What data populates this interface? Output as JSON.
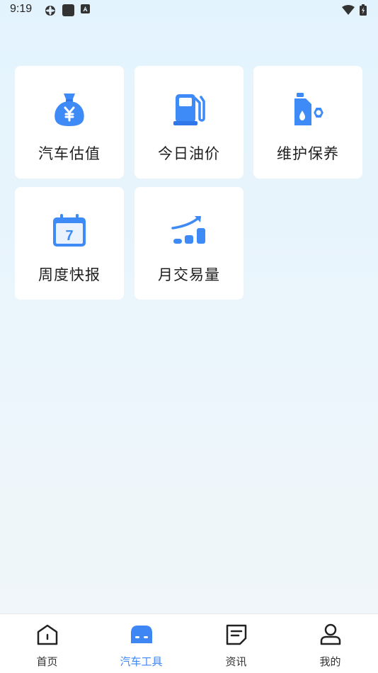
{
  "status_bar": {
    "time": "9:19",
    "icons": [
      "settings-gear-icon",
      "app-square-icon",
      "keyboard-a-icon",
      "wifi-icon",
      "battery-icon"
    ]
  },
  "tools": [
    {
      "label": "汽车估值",
      "icon": "money-bag-icon"
    },
    {
      "label": "今日油价",
      "icon": "fuel-pump-icon"
    },
    {
      "label": "维护保养",
      "icon": "maintenance-oil-icon"
    },
    {
      "label": "周度快报",
      "icon": "calendar-icon"
    },
    {
      "label": "月交易量",
      "icon": "growth-chart-icon"
    }
  ],
  "calendar_day": "7",
  "tabbar": {
    "items": [
      {
        "label": "首页",
        "icon": "home-icon"
      },
      {
        "label": "汽车工具",
        "icon": "car-icon",
        "active": true
      },
      {
        "label": "资讯",
        "icon": "news-icon"
      },
      {
        "label": "我的",
        "icon": "profile-icon"
      }
    ]
  },
  "colors": {
    "accent": "#3f86f5",
    "icon_blue": "#3e8af6",
    "card_bg": "#ffffff"
  }
}
